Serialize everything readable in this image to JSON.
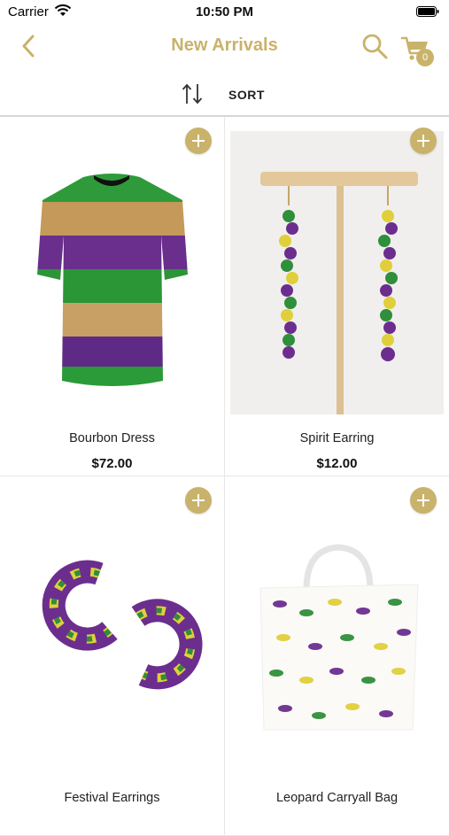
{
  "status_bar": {
    "carrier": "Carrier",
    "time": "10:50 PM"
  },
  "nav": {
    "title": "New Arrivals",
    "cart_count": "0",
    "accent": "#c9b26a"
  },
  "sort": {
    "label": "SORT"
  },
  "products": [
    {
      "name": "Bourbon Dress",
      "price": "$72.00"
    },
    {
      "name": "Spirit Earring",
      "price": "$12.00"
    },
    {
      "name": "Festival Earrings",
      "price": ""
    },
    {
      "name": "Leopard Carryall Bag",
      "price": ""
    }
  ]
}
